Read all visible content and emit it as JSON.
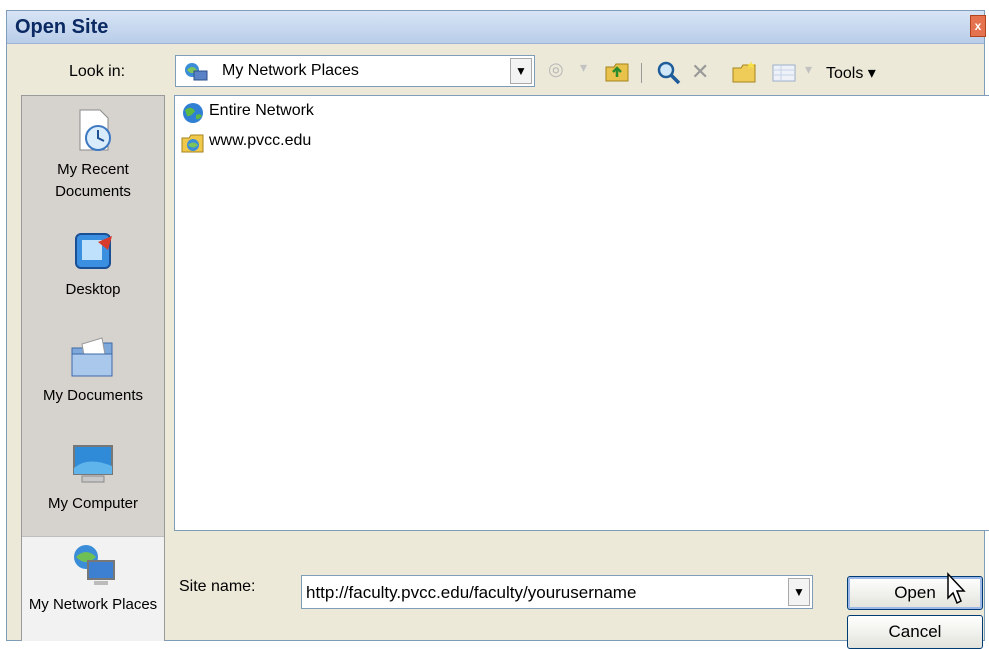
{
  "window": {
    "title": "Open Site",
    "close_label": "x"
  },
  "toolbar": {
    "look_in_label": "Look in:",
    "look_in_value": "My Network Places",
    "tools_label": "Tools",
    "icons": [
      "back-icon",
      "up-folder-icon",
      "search-web-icon",
      "delete-icon",
      "new-folder-icon",
      "views-icon"
    ]
  },
  "places": [
    {
      "label": "My Recent Documents",
      "icon": "recent-documents-icon"
    },
    {
      "label": "Desktop",
      "icon": "desktop-icon"
    },
    {
      "label": "My Documents",
      "icon": "my-documents-icon"
    },
    {
      "label": "My Computer",
      "icon": "my-computer-icon"
    },
    {
      "label": "My Network Places",
      "icon": "network-places-icon",
      "selected": true
    }
  ],
  "files": [
    {
      "name": "Entire Network",
      "icon": "globe-icon"
    },
    {
      "name": "www.pvcc.edu",
      "icon": "web-folder-icon"
    }
  ],
  "site_name": {
    "label": "Site name:",
    "value": "http://faculty.pvcc.edu/faculty/yourusername"
  },
  "buttons": {
    "open": "Open",
    "cancel": "Cancel"
  },
  "colors": {
    "dialog_bg": "#ece9d8",
    "title_text": "#0b2a63",
    "border": "#7f9db9"
  }
}
